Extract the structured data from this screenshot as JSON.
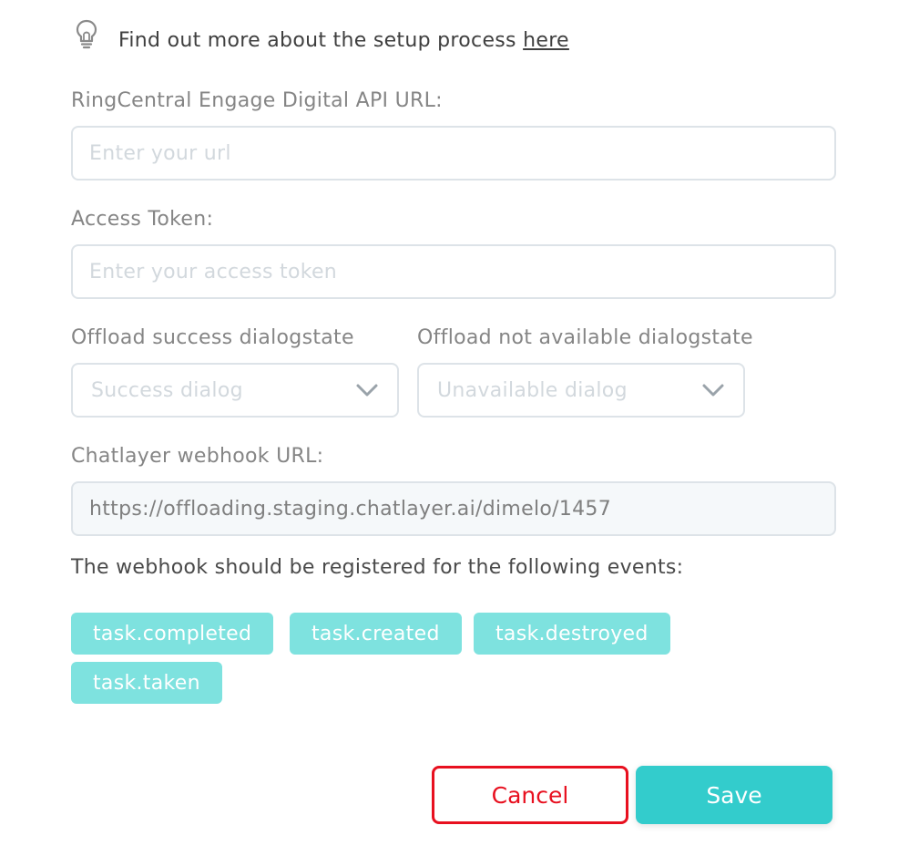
{
  "info": {
    "text": "Find out more about the setup process ",
    "link_label": "here",
    "icon": "lightbulb-icon"
  },
  "fields": {
    "api_url": {
      "label": "RingCentral Engage Digital API URL:",
      "placeholder": "Enter your url",
      "value": ""
    },
    "access_token": {
      "label": "Access Token:",
      "placeholder": "Enter your access token",
      "value": ""
    },
    "offload_success": {
      "label": "Offload success dialogstate",
      "selected": "Success dialog"
    },
    "offload_unavailable": {
      "label": "Offload not available dialogstate",
      "selected": "Unavailable dialog"
    },
    "webhook_url": {
      "label": "Chatlayer webhook URL:",
      "value": "https://offloading.staging.chatlayer.ai/dimelo/1457"
    }
  },
  "events": {
    "note": "The webhook should be registered for the following events:",
    "tags": [
      "task.completed",
      "task.created",
      "task.destroyed",
      "task.taken"
    ]
  },
  "actions": {
    "cancel_label": "Cancel",
    "save_label": "Save"
  },
  "colors": {
    "accent": "#33cccc",
    "tag_bg": "#7ee2df",
    "danger": "#e8101f",
    "input_border": "#dde3e8"
  }
}
